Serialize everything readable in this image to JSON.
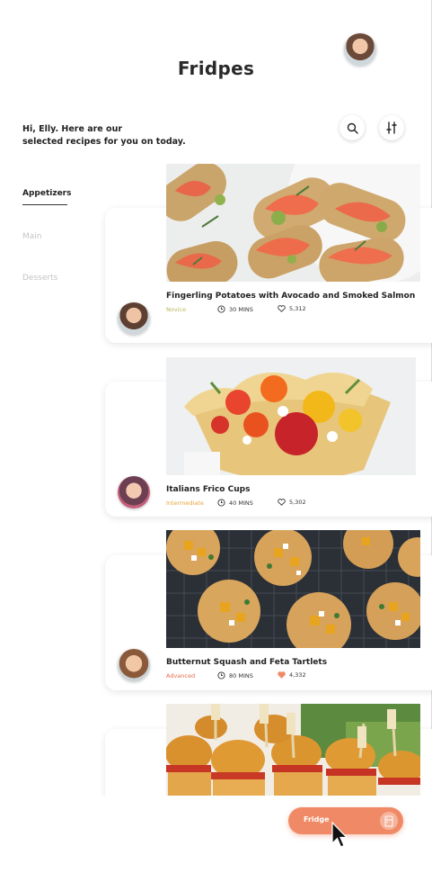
{
  "app": {
    "title": "Fridpes"
  },
  "greeting": {
    "line1": "Hi, Elly. Here are our",
    "line2": "selected recipes for you on today."
  },
  "toolbar": {
    "search_icon": "search-icon",
    "filter_icon": "sliders-icon"
  },
  "categories": [
    {
      "label": "Appetizers",
      "active": true
    },
    {
      "label": "Main",
      "active": false
    },
    {
      "label": "Desserts",
      "active": false
    }
  ],
  "recipes": [
    {
      "title": "Fingerling Potatoes with Avocado and Smoked Salmon",
      "level": "Novice",
      "time": "30 MINS",
      "likes": "5,312",
      "liked": false
    },
    {
      "title": "Italians Frico Cups",
      "level": "Intermediate",
      "time": "40 MINS",
      "likes": "5,302",
      "liked": false
    },
    {
      "title": "Butternut Squash and Feta Tartlets",
      "level": "Advanced",
      "time": "80 MINS",
      "likes": "4,332",
      "liked": true
    },
    {
      "title": "",
      "level": "",
      "time": "",
      "likes": "",
      "liked": false
    }
  ],
  "fridge_button": {
    "label": "Fridge",
    "icon": "fridge-icon"
  },
  "colors": {
    "accent": "#f08a66",
    "novice": "#b7b75a",
    "intermediate": "#e8a43a",
    "advanced": "#e5684a",
    "liked_heart": "#f08a66"
  }
}
